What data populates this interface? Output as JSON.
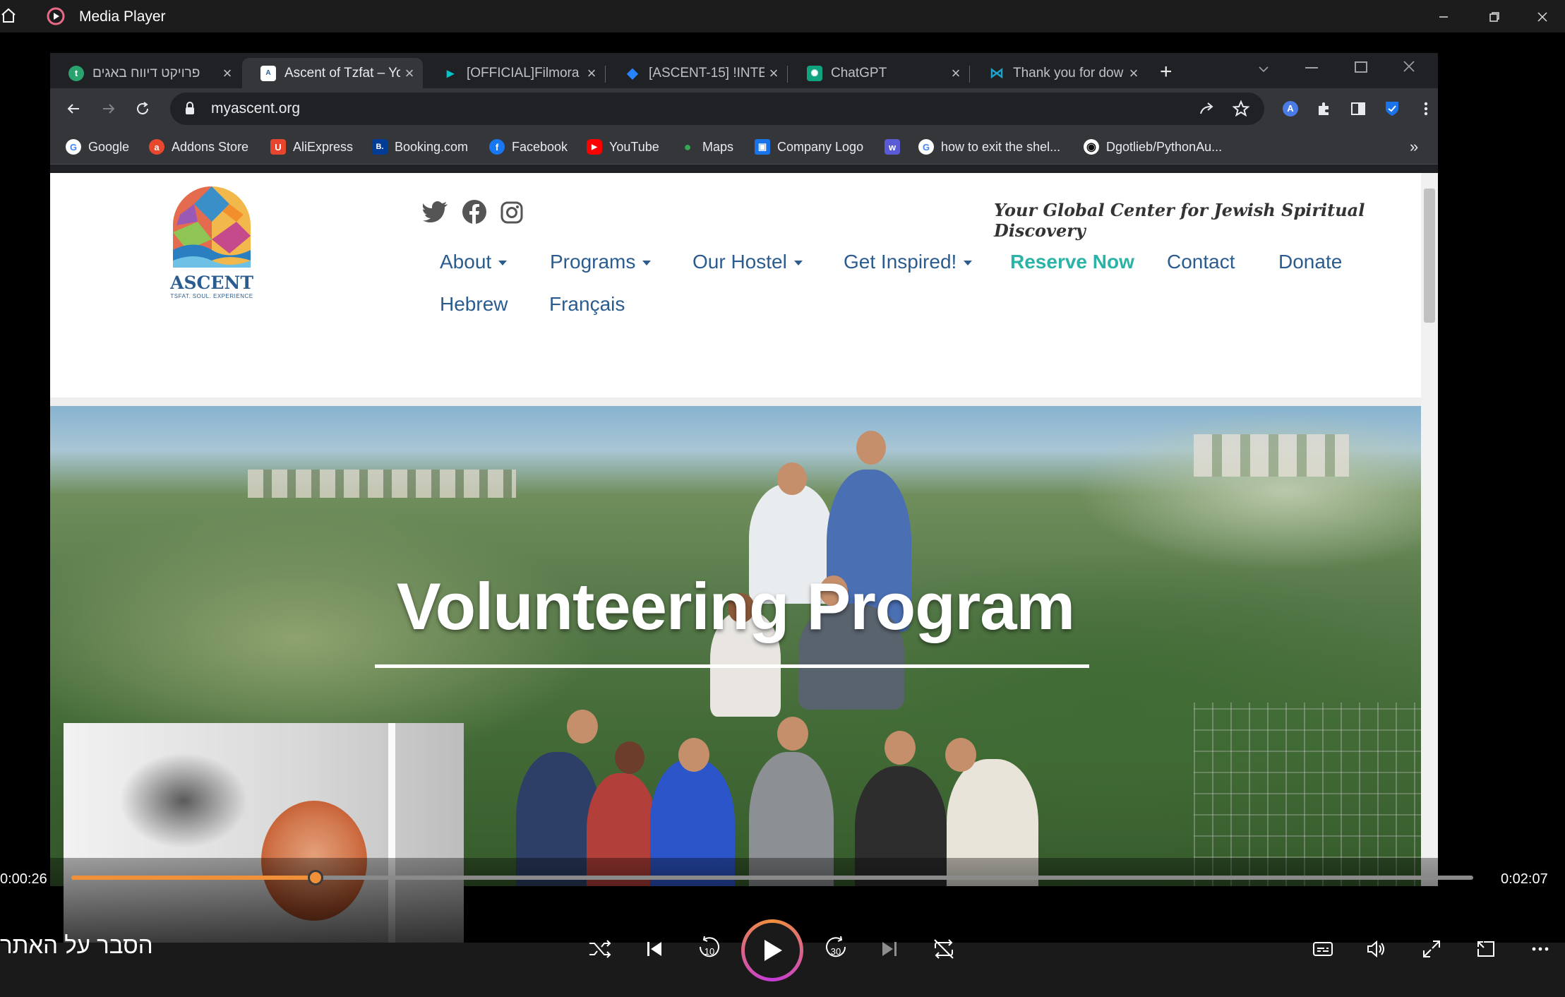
{
  "app": {
    "title": "Media Player"
  },
  "browser": {
    "tabs": [
      {
        "label": "פרויקט דיווח באגים",
        "favicon_color": "#2ba36f",
        "favicon_text": "t"
      },
      {
        "label": "Ascent of Tzfat – Yo",
        "favicon_color": "#ffffff",
        "favicon_text": "A",
        "active": true
      },
      {
        "label": "[OFFICIAL]Filmora V",
        "favicon_color": "#00c4cc",
        "favicon_text": "▸"
      },
      {
        "label": "[ASCENT-15] !INTE",
        "favicon_color": "#2684ff",
        "favicon_text": "◆"
      },
      {
        "label": "ChatGPT",
        "favicon_color": "#10a37f",
        "favicon_text": "✺"
      },
      {
        "label": "Thank you for dow",
        "favicon_color": "#1da1c8",
        "favicon_text": "⋈"
      }
    ],
    "url": "myascent.org",
    "bookmarks": [
      {
        "label": "Google",
        "color": "#ffffff",
        "glyph": "G"
      },
      {
        "label": "Addons Store",
        "color": "#e8492e",
        "glyph": "a"
      },
      {
        "label": "AliExpress",
        "color": "#e8452e",
        "glyph": "U"
      },
      {
        "label": "Booking.com",
        "color": "#003b95",
        "glyph": "B."
      },
      {
        "label": "Facebook",
        "color": "#1877f2",
        "glyph": "f"
      },
      {
        "label": "YouTube",
        "color": "#ff0000",
        "glyph": "▶"
      },
      {
        "label": "Maps",
        "color": "#34a853",
        "glyph": "●"
      },
      {
        "label": "Company Logo",
        "color": "#1a73e8",
        "glyph": "▣"
      },
      {
        "label": "",
        "color": "#5b5bd6",
        "glyph": "w"
      },
      {
        "label": "how to exit the shel...",
        "color": "#ffffff",
        "glyph": "G"
      },
      {
        "label": "Dgotlieb/PythonAu...",
        "color": "#ffffff",
        "glyph": "◉"
      }
    ],
    "more_bookmarks": "»"
  },
  "site": {
    "logo_text": "ASCENT",
    "logo_sub": "TSFAT. SOUL. EXPERIENCE",
    "tagline": "Your Global Center for Jewish Spiritual Discovery",
    "nav": [
      {
        "label": "About",
        "dropdown": true
      },
      {
        "label": "Programs",
        "dropdown": true
      },
      {
        "label": "Our Hostel",
        "dropdown": true
      },
      {
        "label": "Get Inspired!",
        "dropdown": true
      },
      {
        "label": "Reserve Now",
        "highlight": true
      },
      {
        "label": "Contact"
      },
      {
        "label": "Donate"
      }
    ],
    "nav_row2": [
      {
        "label": "Hebrew"
      },
      {
        "label": "Français"
      }
    ],
    "hero_title": "Volunteering Program",
    "colors": {
      "nav": "#2b5c8f",
      "highlight": "#2ab3a6"
    }
  },
  "player": {
    "current_time": "0:00:26",
    "total_time": "0:02:07",
    "progress": 0.174,
    "subtitle": "הסבר על האתר",
    "accent": "#f0913a"
  }
}
